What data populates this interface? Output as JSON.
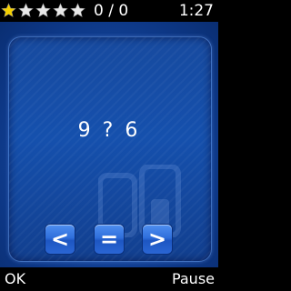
{
  "status": {
    "stars_total": 5,
    "stars_filled": 1,
    "score": "0 / 0",
    "timer": "1:27"
  },
  "colors": {
    "star_filled": "#f5d000",
    "star_empty": "#e8e8e8",
    "background": "#1648a0",
    "button": "#2f6fdc"
  },
  "puzzle": {
    "expression": "9 ? 6"
  },
  "buttons": {
    "less": "<",
    "equal": "=",
    "greater": ">"
  },
  "softkeys": {
    "left": "OK",
    "right": "Pause"
  }
}
